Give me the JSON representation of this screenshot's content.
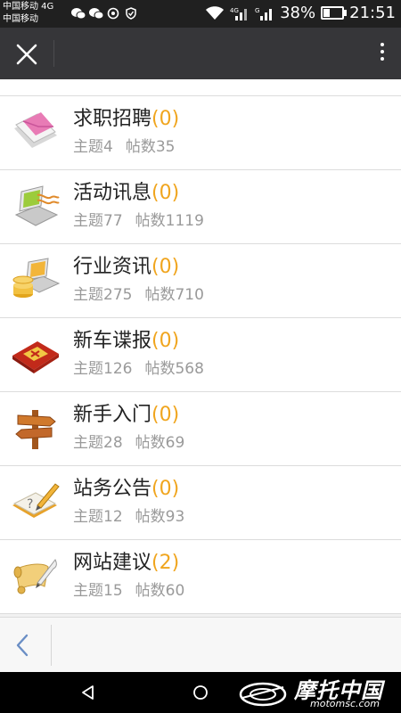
{
  "status_bar": {
    "carrier_line1": "中国移动 4G",
    "carrier_line2": "中国移动",
    "battery": "38%",
    "time": "21:51"
  },
  "forum_list": [
    {
      "title": "求职招聘",
      "new_count": "(0)",
      "topics": "主题4",
      "posts": "帖数35",
      "icon": "envelope-icon"
    },
    {
      "title": "活动讯息",
      "new_count": "(0)",
      "topics": "主题77",
      "posts": "帖数1119",
      "icon": "laptop-wave-icon"
    },
    {
      "title": "行业资讯",
      "new_count": "(0)",
      "topics": "主题275",
      "posts": "帖数710",
      "icon": "laptop-coins-icon"
    },
    {
      "title": "新车谍报",
      "new_count": "(0)",
      "topics": "主题126",
      "posts": "帖数568",
      "icon": "red-card-icon"
    },
    {
      "title": "新手入门",
      "new_count": "(0)",
      "topics": "主题28",
      "posts": "帖数69",
      "icon": "signpost-icon"
    },
    {
      "title": "站务公告",
      "new_count": "(0)",
      "topics": "主题12",
      "posts": "帖数93",
      "icon": "notebook-pencil-icon"
    },
    {
      "title": "网站建议",
      "new_count": "(2)",
      "topics": "主题15",
      "posts": "帖数60",
      "icon": "scroll-quill-icon"
    }
  ],
  "watermark": {
    "name": "摩托中国",
    "url": "motomsc.com"
  }
}
